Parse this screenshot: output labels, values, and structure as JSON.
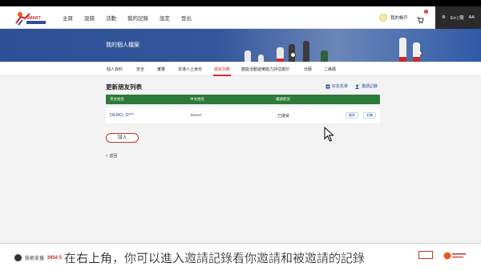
{
  "nav": {
    "logo_text": "Smart Play",
    "items": [
      "主頁",
      "設施",
      "活動",
      "我的記錄",
      "設定",
      "登出"
    ],
    "account_label": "我的帳戶",
    "cart_count": "1",
    "tools": {
      "language": "En | 簡",
      "font_size": "AA"
    }
  },
  "banner": {
    "title": "我的個人檔案"
  },
  "subtabs": [
    "個人資料",
    "安全",
    "實豐",
    "本港人士身份",
    "朋友列表",
    "體能活動遊樂能力評估獎印",
    "日曆",
    "二維碼"
  ],
  "content": {
    "title": "更新朋友列表",
    "actions": {
      "friend_record": "好友名單",
      "invite_record": "邀請記錄"
    },
    "table": {
      "headers": [
        "英文姓名",
        "中文姓名",
        "邀請狀況"
      ],
      "rows": [
        {
          "english_name": "DEMO, D***",
          "chinese_name": "Demo*",
          "status": "已接受",
          "btn_remove": "刪除",
          "btn_block": "封鎖"
        }
      ]
    },
    "add_button": "加入",
    "back_label": "返回"
  },
  "footer": {
    "hotline_label": "技術支援:",
    "hotline_number": "3954 5"
  },
  "caption": "在右上角，你可以進入邀請記錄看你邀請和被邀請的記錄"
}
